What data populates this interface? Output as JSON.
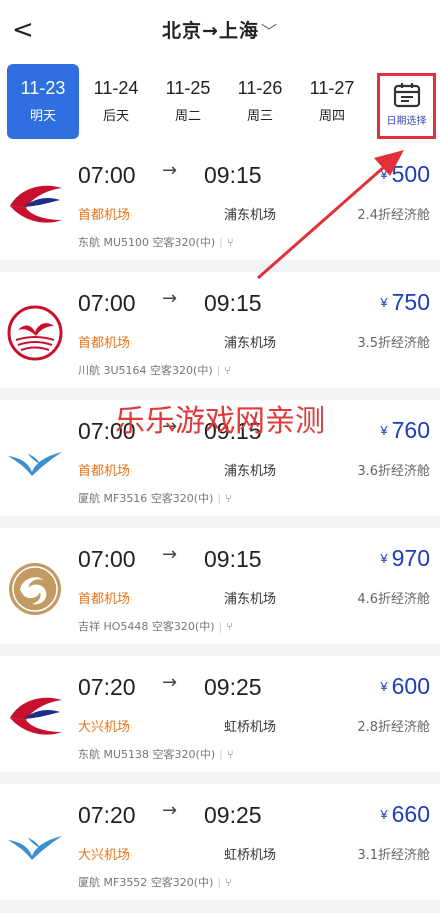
{
  "header": {
    "route": "北京→上海",
    "chevron": "﹀"
  },
  "dates": [
    {
      "date": "11-23",
      "weekday": "明天"
    },
    {
      "date": "11-24",
      "weekday": "后天"
    },
    {
      "date": "11-25",
      "weekday": "周二"
    },
    {
      "date": "11-26",
      "weekday": "周三"
    },
    {
      "date": "11-27",
      "weekday": "周四"
    }
  ],
  "date_picker": {
    "label": "日期选择"
  },
  "watermark": "乐乐游戏网亲测",
  "currency": "¥",
  "flights": [
    {
      "dep": "07:00",
      "arr": "09:15",
      "price": "500",
      "dep_airport": "首都机场",
      "arr_airport": "浦东机场",
      "class": "2.4折经济舱",
      "airline": "东航 MU5100",
      "aircraft": "空客320(中)"
    },
    {
      "dep": "07:00",
      "arr": "09:15",
      "price": "750",
      "dep_airport": "首都机场",
      "arr_airport": "浦东机场",
      "class": "3.5折经济舱",
      "airline": "川航 3U5164",
      "aircraft": "空客320(中)"
    },
    {
      "dep": "07:00",
      "arr": "09:15",
      "price": "760",
      "dep_airport": "首都机场",
      "arr_airport": "浦东机场",
      "class": "3.6折经济舱",
      "airline": "厦航 MF3516",
      "aircraft": "空客320(中)"
    },
    {
      "dep": "07:00",
      "arr": "09:15",
      "price": "970",
      "dep_airport": "首都机场",
      "arr_airport": "浦东机场",
      "class": "4.6折经济舱",
      "airline": "吉祥 HO5448",
      "aircraft": "空客320(中)"
    },
    {
      "dep": "07:20",
      "arr": "09:25",
      "price": "600",
      "dep_airport": "大兴机场",
      "arr_airport": "虹桥机场",
      "class": "2.8折经济舱",
      "airline": "东航 MU5138",
      "aircraft": "空客320(中)"
    },
    {
      "dep": "07:20",
      "arr": "09:25",
      "price": "660",
      "dep_airport": "大兴机场",
      "arr_airport": "虹桥机场",
      "class": "3.1折经济舱",
      "airline": "厦航 MF3552",
      "aircraft": "空客320(中)"
    }
  ],
  "colors": {
    "accent_blue": "#2f6fe0",
    "price_blue": "#1c3fb6",
    "airport_orange": "#e5761b",
    "highlight_red": "#e0313a"
  }
}
